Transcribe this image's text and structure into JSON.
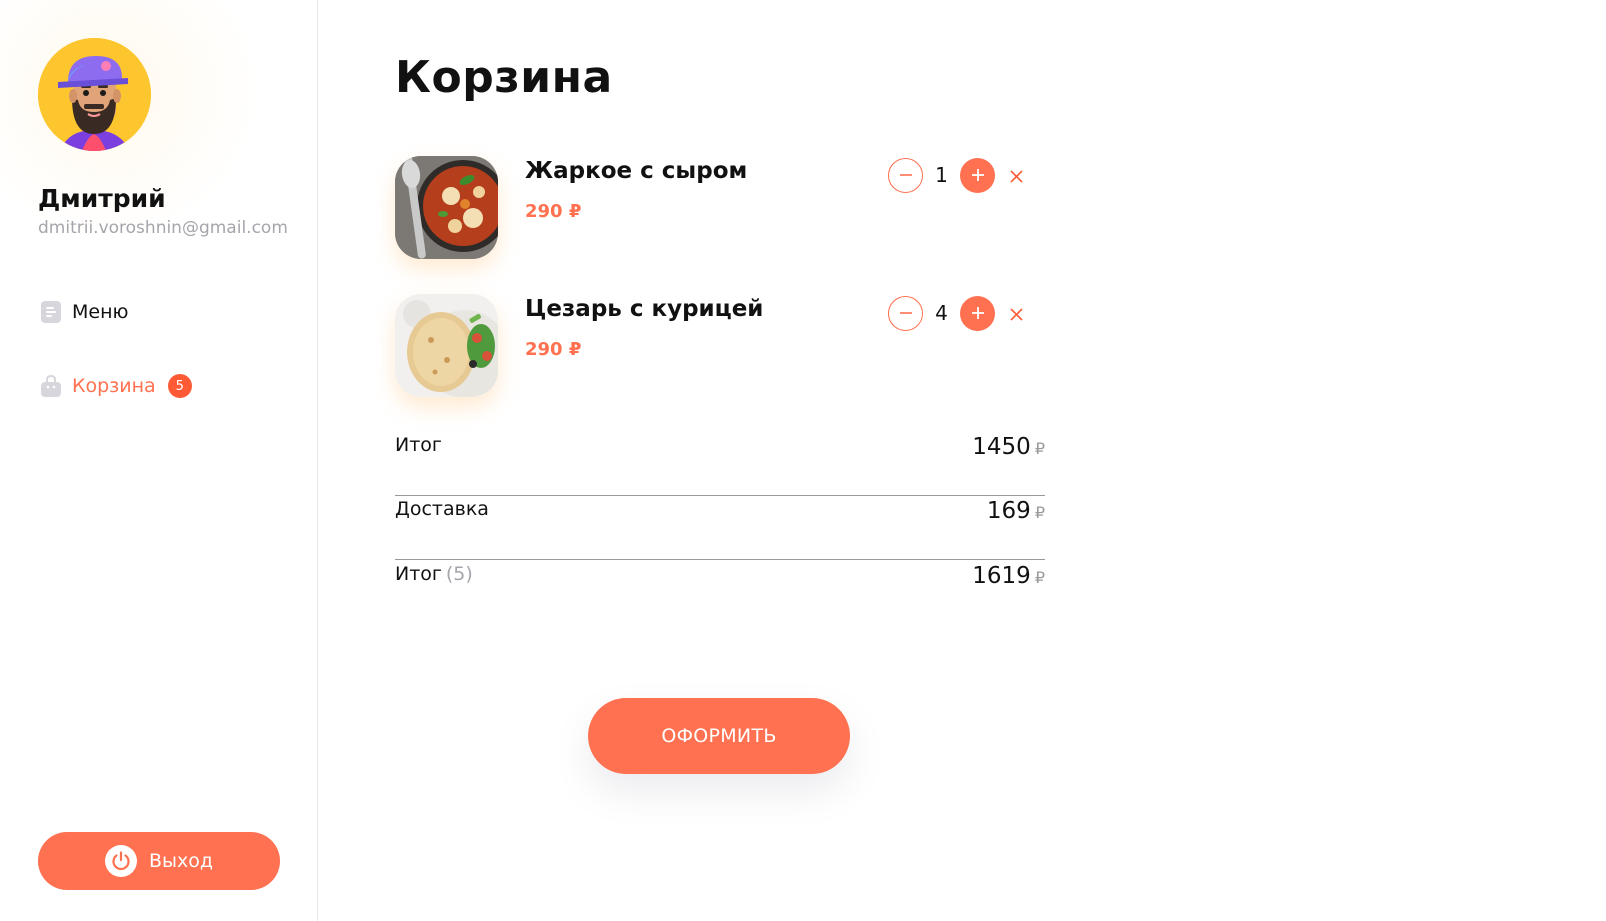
{
  "colors": {
    "accent": "#ff7150",
    "badge": "#ff5a36",
    "text": "#111111",
    "muted": "#a5a5ac",
    "divider": "#9a9a9a"
  },
  "user": {
    "name": "Дмитрий",
    "email": "dmitrii.voroshnin@gmail.com",
    "avatar_icon": "bearded-man-avatar"
  },
  "sidebar": {
    "items": [
      {
        "label": "Меню",
        "icon": "document-icon",
        "active": false
      },
      {
        "label": "Корзина",
        "icon": "shopping-bag-icon",
        "active": true,
        "badge": "5"
      }
    ],
    "logout": {
      "label": "Выход",
      "icon": "power-icon"
    }
  },
  "cart": {
    "title": "Корзина",
    "items": [
      {
        "name": "Жаркое с сыром",
        "price": "290 ₽",
        "quantity": "1",
        "image": "stew-dish-photo"
      },
      {
        "name": "Цезарь с курицей",
        "price": "290 ₽",
        "quantity": "4",
        "image": "caesar-wrap-photo"
      }
    ],
    "summary": [
      {
        "label": "Итог",
        "count": "",
        "value": "1450",
        "currency": "₽"
      },
      {
        "label": "Доставка",
        "count": "",
        "value": "169",
        "currency": "₽"
      },
      {
        "label": "Итог",
        "count": "(5)",
        "value": "1619",
        "currency": "₽"
      }
    ],
    "checkout_label": "ОФОРМИТЬ"
  }
}
